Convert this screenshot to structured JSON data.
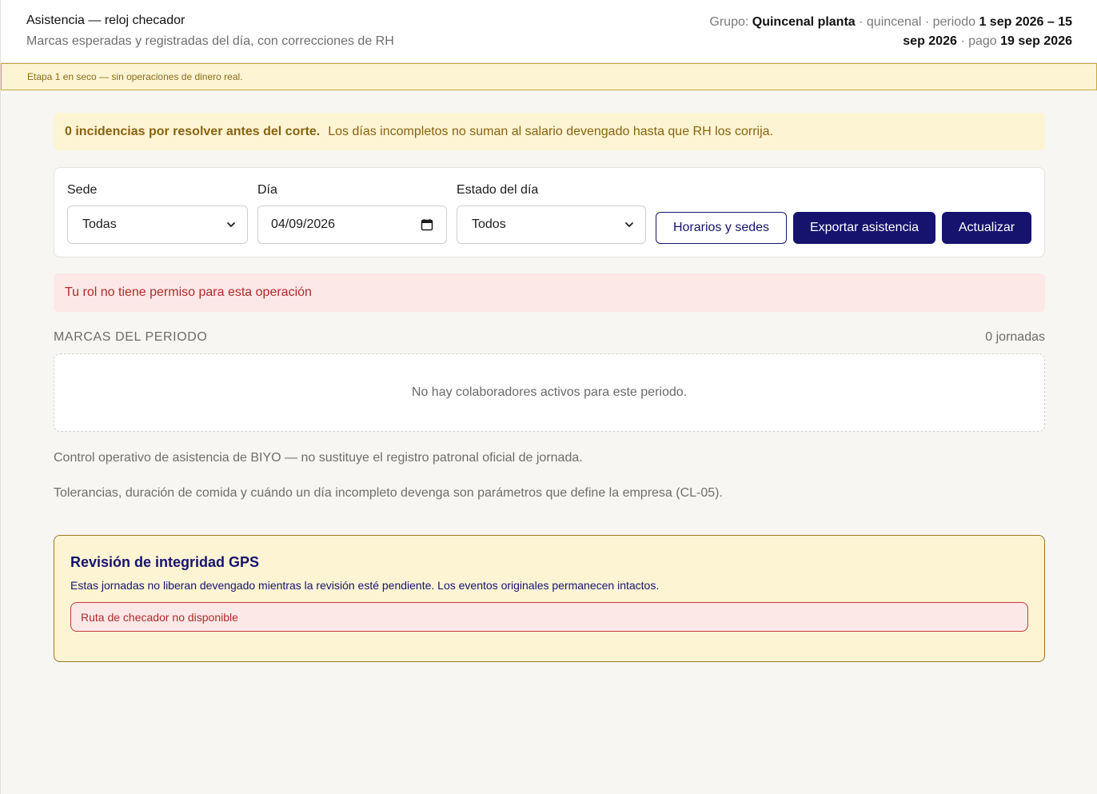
{
  "header": {
    "title": "Asistencia — reloj checador",
    "subtitle": "Marcas esperadas y registradas del día, con correcciones de RH",
    "grupo_label": "Grupo:",
    "grupo_name": "Quincenal planta",
    "sep1": " · quincenal · periodo ",
    "periodo": "1 sep 2026 – 15 sep 2026",
    "sep2": " · pago ",
    "pago": "19 sep 2026"
  },
  "etapa_banner": "Etapa 1 en seco — sin operaciones de dinero real.",
  "incidencias": {
    "bold": "0 incidencias por resolver antes del corte.",
    "text": "Los días incompletos no suman al salario devengado hasta que RH los corrija."
  },
  "filters": {
    "sede_label": "Sede",
    "sede_value": "Todas",
    "dia_label": "Día",
    "dia_value": "04/09/2026",
    "estado_label": "Estado del día",
    "estado_value": "Todos"
  },
  "buttons": {
    "horarios": "Horarios y sedes",
    "exportar": "Exportar asistencia",
    "actualizar": "Actualizar"
  },
  "error_permiso": "Tu rol no tiene permiso para esta operación",
  "marcas": {
    "section_label": "MARCAS DEL PERIODO",
    "count": "0 jornadas",
    "empty": "No hay colaboradores activos para este periodo."
  },
  "notes": {
    "n1": "Control operativo de asistencia de BIYO — no sustituye el registro patronal oficial de jornada.",
    "n2": "Tolerancias, duración de comida y cuándo un día incompleto devenga son parámetros que define la empresa (CL-05)."
  },
  "gps": {
    "title": "Revisión de integridad GPS",
    "desc": "Estas jornadas no liberan devengado mientras la revisión esté pendiente. Los eventos originales permanecen intactos.",
    "error": "Ruta de checador no disponible"
  },
  "colors": {
    "accent": "#16136e",
    "warning_bg": "#fdf4d4",
    "error_bg": "#fde8e8",
    "error_text": "#b22a2a"
  },
  "icons": {
    "select": "chevron-down-icon",
    "date": "calendar-icon"
  }
}
